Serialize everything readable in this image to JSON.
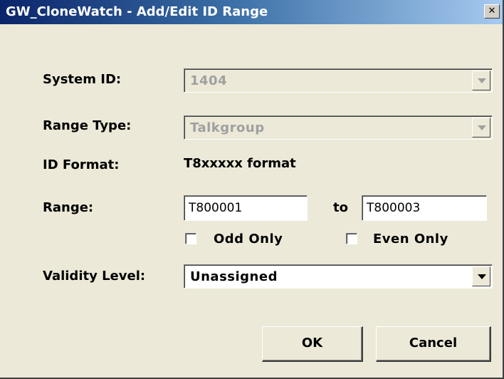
{
  "window": {
    "title": "GW_CloneWatch - Add/Edit ID Range",
    "close_glyph": "✕",
    "close_icon": "close-icon"
  },
  "form": {
    "system_id_label": "System ID:",
    "system_id_value": "1404",
    "range_type_label": "Range Type:",
    "range_type_value": "Talkgroup",
    "id_format_label": "ID Format:",
    "id_format_value": "T8xxxxx format",
    "range_label": "Range:",
    "range_from": "T800001",
    "range_to_label": "to",
    "range_to": "T800003",
    "odd_only_label": "Odd Only",
    "odd_only_checked": false,
    "even_only_label": "Even Only",
    "even_only_checked": false,
    "validity_label": "Validity Level:",
    "validity_value": "Unassigned"
  },
  "buttons": {
    "ok_label": "OK",
    "cancel_label": "Cancel"
  },
  "icons": {
    "dropdown": "chevron-down-icon"
  },
  "colors": {
    "title_gradient_start": "#0a246a",
    "title_gradient_end": "#a6caf0",
    "dialog_bg": "#ece9d8",
    "disabled_text": "#a0a0a0"
  }
}
